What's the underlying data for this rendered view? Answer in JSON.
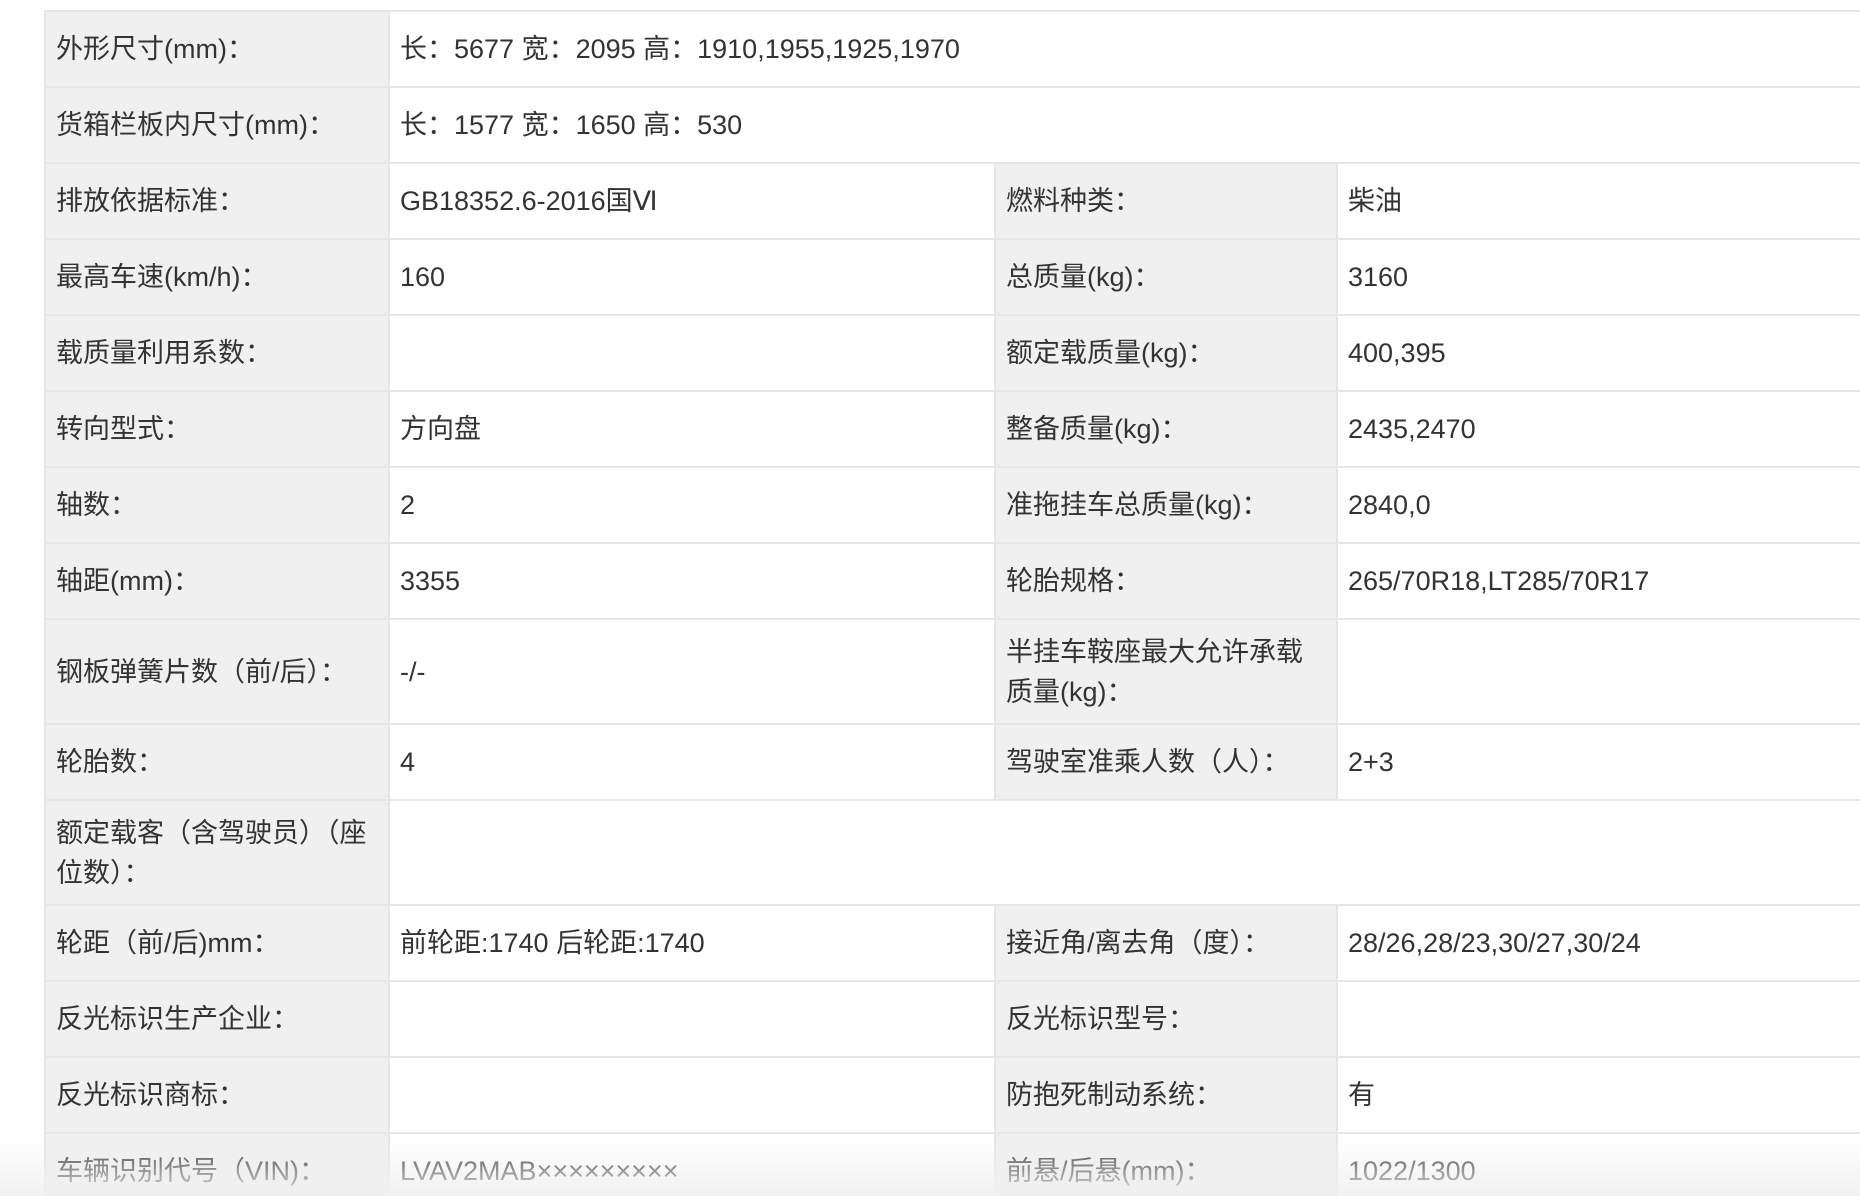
{
  "rows": [
    {
      "l1": "外形尺寸(mm)：",
      "v1": "长：5677 宽：2095 高：1910,1955,1925,1970"
    },
    {
      "l1": "货箱栏板内尺寸(mm)：",
      "v1": "长：1577 宽：1650 高：530"
    },
    {
      "l1": "排放依据标准：",
      "v1": "GB18352.6-2016国Ⅵ",
      "l2": "燃料种类：",
      "v2": "柴油"
    },
    {
      "l1": "最高车速(km/h)：",
      "v1": "160",
      "l2": "总质量(kg)：",
      "v2": "3160"
    },
    {
      "l1": "载质量利用系数：",
      "v1": "",
      "l2": "额定载质量(kg)：",
      "v2": "400,395"
    },
    {
      "l1": "转向型式：",
      "v1": "方向盘",
      "l2": "整备质量(kg)：",
      "v2": "2435,2470"
    },
    {
      "l1": "轴数：",
      "v1": "2",
      "l2": "准拖挂车总质量(kg)：",
      "v2": "2840,0"
    },
    {
      "l1": "轴距(mm)：",
      "v1": "3355",
      "l2": "轮胎规格：",
      "v2": "265/70R18,LT285/70R17"
    },
    {
      "l1": "钢板弹簧片数（前/后）：",
      "v1": "-/-",
      "l2": "半挂车鞍座最大允许承载质量(kg)：",
      "v2": ""
    },
    {
      "l1": "轮胎数：",
      "v1": "4",
      "l2": "驾驶室准乘人数（人）：",
      "v2": "2+3"
    },
    {
      "l1": "额定载客（含驾驶员）（座位数）：",
      "v1": ""
    },
    {
      "l1": "轮距（前/后)mm：",
      "v1": "前轮距:1740 后轮距:1740",
      "l2": "接近角/离去角（度）：",
      "v2": "28/26,28/23,30/27,30/24"
    },
    {
      "l1": "反光标识生产企业：",
      "v1": "",
      "l2": "反光标识型号：",
      "v2": ""
    },
    {
      "l1": "反光标识商标：",
      "v1": "",
      "l2": "防抱死制动系统：",
      "v2": "有"
    },
    {
      "l1": "车辆识别代号（VIN)：",
      "v1": "LVAV2MAB×××××××××",
      "l2": "前悬/后悬(mm)：",
      "v2": "1022/1300"
    }
  ]
}
